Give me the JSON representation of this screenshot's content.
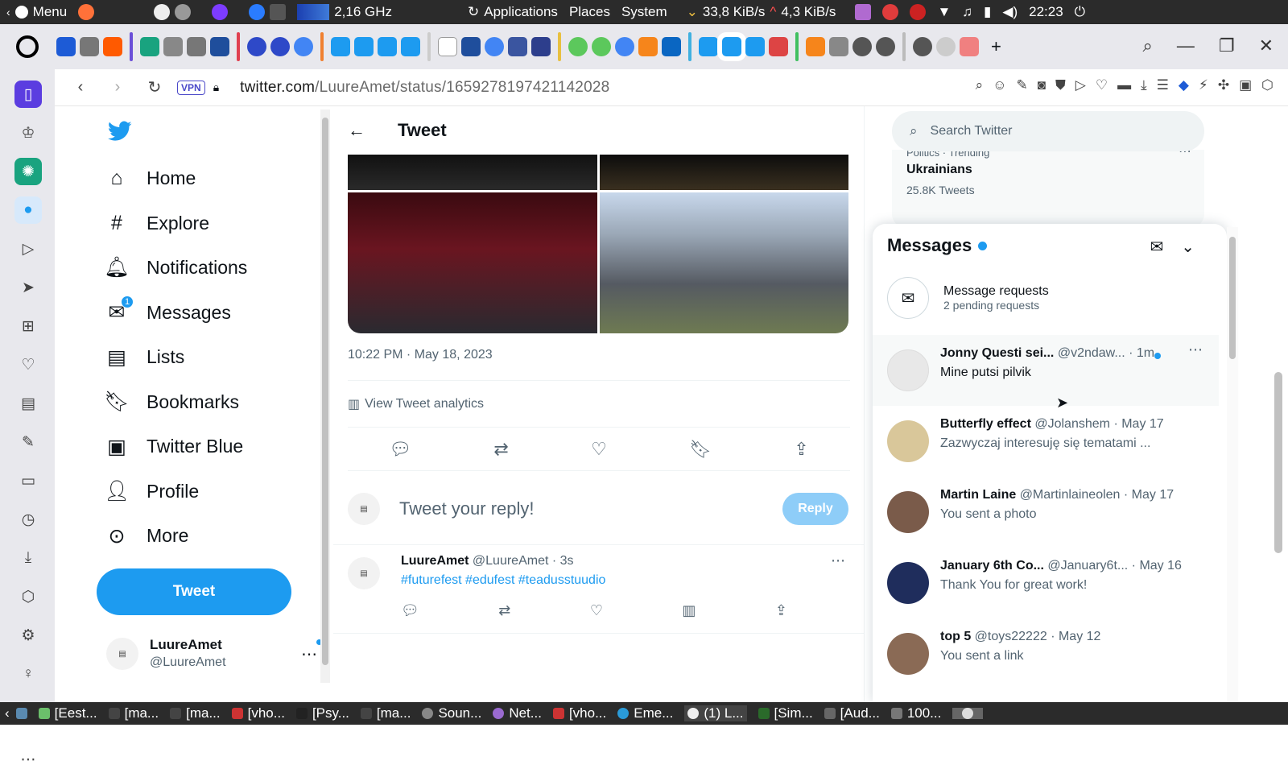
{
  "os_panel": {
    "menu": "Menu",
    "cpu": "2,16 GHz",
    "applications": "Applications",
    "places": "Places",
    "system": "System",
    "net_down": "33,8 KiB/s",
    "net_up": "4,3 KiB/s",
    "clock": "22:23"
  },
  "browser": {
    "vpn": "VPN",
    "url_host": "twitter.com",
    "url_path": "/LuureAmet/status/1659278197421142028"
  },
  "nav": {
    "items": [
      {
        "label": "Home",
        "icon": "home-icon"
      },
      {
        "label": "Explore",
        "icon": "hashtag-icon"
      },
      {
        "label": "Notifications",
        "icon": "bell-icon"
      },
      {
        "label": "Messages",
        "icon": "envelope-icon",
        "badge": "1"
      },
      {
        "label": "Lists",
        "icon": "list-icon"
      },
      {
        "label": "Bookmarks",
        "icon": "bookmark-icon"
      },
      {
        "label": "Twitter Blue",
        "icon": "twitter-blue-icon"
      },
      {
        "label": "Profile",
        "icon": "person-icon"
      },
      {
        "label": "More",
        "icon": "more-circle-icon"
      }
    ],
    "tweet_button": "Tweet",
    "account": {
      "name": "LuureAmet",
      "handle": "@LuureAmet"
    }
  },
  "tweet": {
    "header": "Tweet",
    "timestamp": "10:22 PM · May 18, 2023",
    "analytics": "View Tweet analytics",
    "reply_placeholder": "Tweet your reply!",
    "reply_button": "Reply"
  },
  "reply_tweet": {
    "name": "LuureAmet",
    "handle": "@LuureAmet",
    "time": "· 3s",
    "tags": "#futurefest #edufest #teadusstuudio"
  },
  "search": {
    "placeholder": "Search Twitter"
  },
  "trend": {
    "category": "Politics · Trending",
    "name": "Ukrainians",
    "count": "25.8K Tweets"
  },
  "messages": {
    "title": "Messages",
    "requests_title": "Message requests",
    "requests_sub": "2 pending requests",
    "conversations": [
      {
        "name": "Jonny Questi sei...",
        "handle": "@v2ndaw...",
        "time": "· 1m",
        "preview": "Mine putsi pilvik",
        "unread": true,
        "color": "#e8e8e8"
      },
      {
        "name": "Butterfly effect",
        "handle": "@Jolanshem",
        "time": "· May 17",
        "preview": "Zazwyczaj interesuję się tematami ...",
        "unread": false,
        "color": "#d9c79a"
      },
      {
        "name": "Martin Laine",
        "handle": "@Martinlaineolen",
        "time": "· May 17",
        "preview": "You sent a photo",
        "unread": false,
        "color": "#7a5b4a"
      },
      {
        "name": "January 6th Co...",
        "handle": "@January6t...",
        "time": "· May 16",
        "preview": "Thank You for great work!",
        "unread": false,
        "color": "#1f2d5c"
      },
      {
        "name": "top 5",
        "handle": "@toys22222",
        "time": "· May 12",
        "preview": "You sent a link",
        "unread": false,
        "color": "#8a6a55"
      }
    ]
  },
  "taskbar": {
    "items": [
      "[Eest...",
      "[ma...",
      "[ma...",
      "[vho...",
      "[Psy...",
      "[ma...",
      "Soun...",
      "Net...",
      "[vho...",
      "Eme...",
      "(1) L...",
      "[Sim...",
      "[Aud...",
      "100..."
    ]
  }
}
